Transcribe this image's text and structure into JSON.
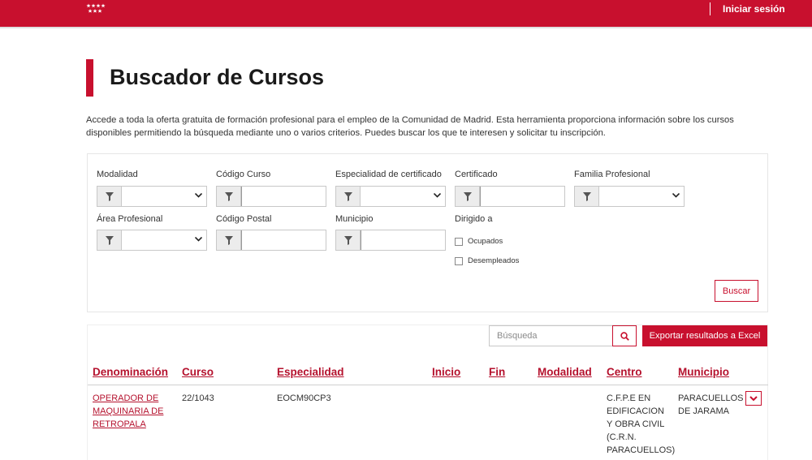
{
  "header": {
    "login_label": "Iniciar sesión",
    "brand_color": "#c8102e"
  },
  "page": {
    "title": "Buscador de Cursos",
    "intro_line1": "Accede a toda la oferta gratuita de formación profesional para el empleo de la Comunidad de Madrid. Esta herramienta proporciona información sobre los cursos",
    "intro_line2": "disponibles permitiendo la búsqueda mediante uno o varios criterios. Puedes buscar los que te interesen y solicitar tu inscripción."
  },
  "filters": {
    "modalidad": {
      "label": "Modalidad",
      "value": ""
    },
    "codigo_curso": {
      "label": "Código Curso",
      "value": ""
    },
    "especialidad": {
      "label": "Especialidad de certificado",
      "value": ""
    },
    "certificado": {
      "label": "Certificado",
      "value": ""
    },
    "familia": {
      "label": "Familia Profesional",
      "value": ""
    },
    "area": {
      "label": "Área Profesional",
      "value": ""
    },
    "codigo_postal": {
      "label": "Código Postal",
      "value": ""
    },
    "municipio": {
      "label": "Municipio",
      "value": ""
    },
    "dirigido": {
      "label": "Dirigido a",
      "options": [
        {
          "label": "Ocupados",
          "checked": false
        },
        {
          "label": "Desempleados",
          "checked": false
        }
      ]
    },
    "search_button": "Buscar"
  },
  "results": {
    "search_placeholder": "Búsqueda",
    "export_label": "Exportar resultados a Excel",
    "columns": [
      "Denominación",
      "Curso",
      "Especialidad",
      "Inicio",
      "Fin",
      "Modalidad",
      "Centro",
      "Municipio"
    ],
    "rows": [
      {
        "denominacion": [
          "OPERADOR DE",
          "MAQUINARIA DE",
          "RETROPALA"
        ],
        "curso": "22/1043",
        "especialidad": "EOCM90CP3",
        "inicio": "",
        "fin": "",
        "modalidad": "",
        "centro": [
          "C.F.P.E EN",
          "EDIFICACION",
          "Y OBRA CIVIL",
          "(C.R.N.",
          "PARACUELLOS)"
        ],
        "municipio": [
          "PARACUELLOS",
          "DE JARAMA"
        ]
      }
    ]
  },
  "icons": {
    "filter": "filter-funnel-icon",
    "search": "magnifier-icon",
    "expand": "chevron-down-icon",
    "logo": "madrid-stars-logo"
  }
}
